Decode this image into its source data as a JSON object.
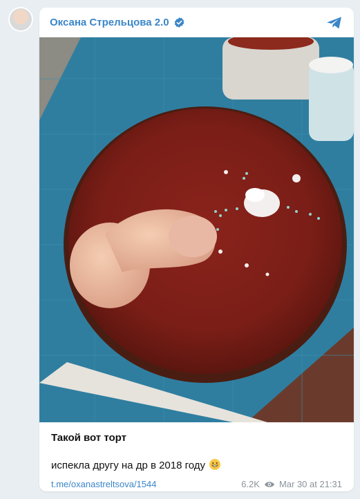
{
  "channel": {
    "name": "Оксана Стрельцова 2.0",
    "verified": true
  },
  "post": {
    "title": "Такой вот торт",
    "text": "испекла другу на др в 2018 году",
    "emoji": "grinning-face",
    "link": "t.me/oxanastreltsova/1544",
    "views": "6.2K",
    "date": "Mar 30 at 21:31"
  },
  "colors": {
    "accent": "#3a86c8",
    "meta": "#8a949c",
    "background": "#e9eef2"
  }
}
